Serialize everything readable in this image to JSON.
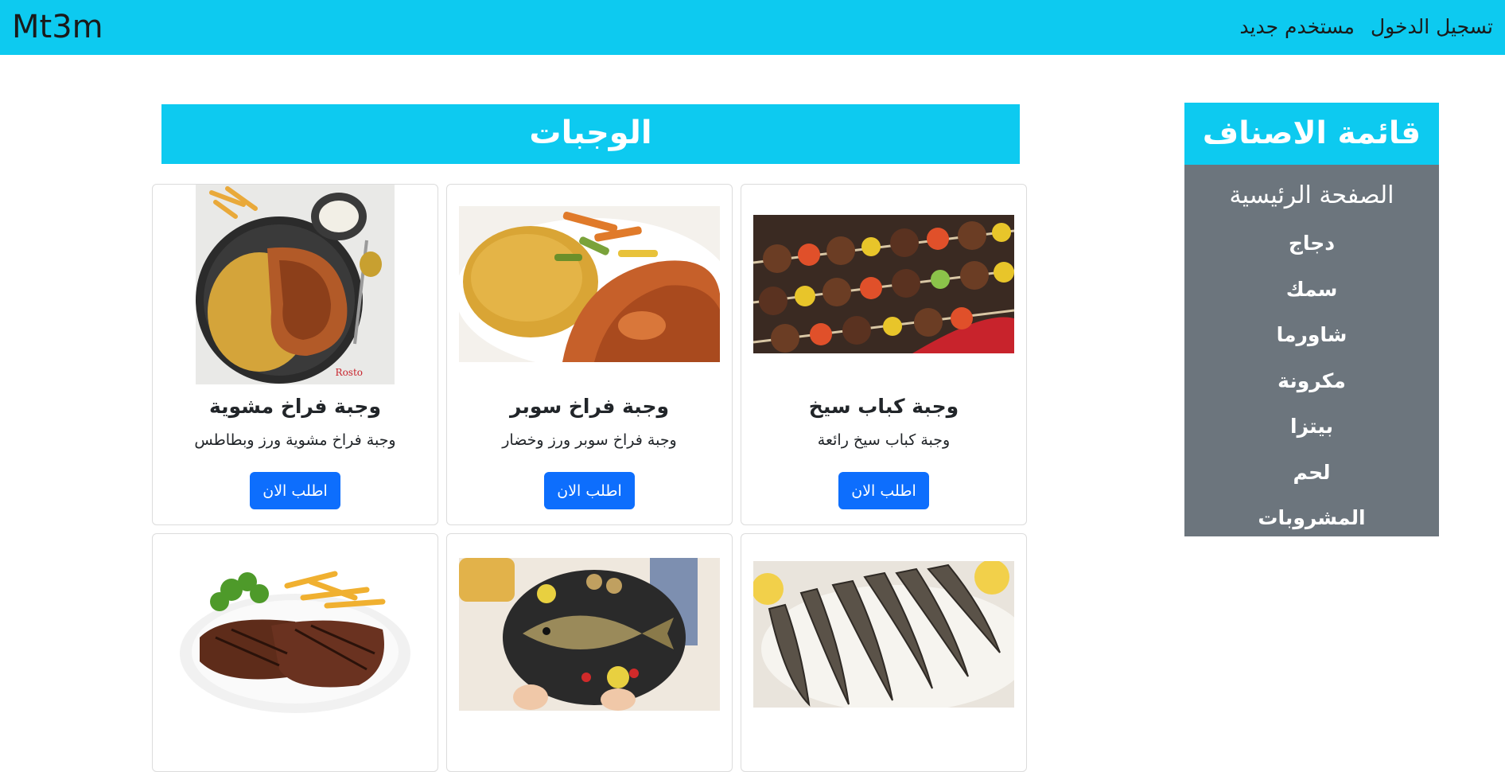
{
  "navbar": {
    "brand": "Mt3m",
    "links": [
      "تسجيل الدخول",
      "مستخدم جديد"
    ]
  },
  "sidebar": {
    "title": "قائمة الاصناف",
    "items": [
      "الصفحة الرئيسية",
      "دجاج",
      "سمك",
      "شاورما",
      "مكرونة",
      "بيتزا",
      "لحم",
      "المشروبات"
    ]
  },
  "section": {
    "title": "الوجبات"
  },
  "cards": [
    {
      "title": "وجبة كباب سيخ",
      "text": "وجبة كباب سيخ رائعة",
      "button": "اطلب الان",
      "image": "kebab-skewers-photo"
    },
    {
      "title": "وجبة فراخ سوبر",
      "text": "وجبة فراخ سوبر ورز وخضار",
      "button": "اطلب الان",
      "image": "chicken-rice-vegetables-photo"
    },
    {
      "title": "وجبة فراخ مشوية",
      "text": "وجبة فراخ مشوية ورز وبطاطس",
      "button": "اطلب الان",
      "image": "grilled-chicken-rice-photo"
    },
    {
      "image": "grilled-sardines-photo"
    },
    {
      "image": "grilled-fish-plate-photo"
    },
    {
      "image": "steak-fries-photo"
    }
  ],
  "colors": {
    "navbar": "#0dcaf0",
    "sidebar_body": "#6c757d",
    "button": "#0d6efd"
  }
}
